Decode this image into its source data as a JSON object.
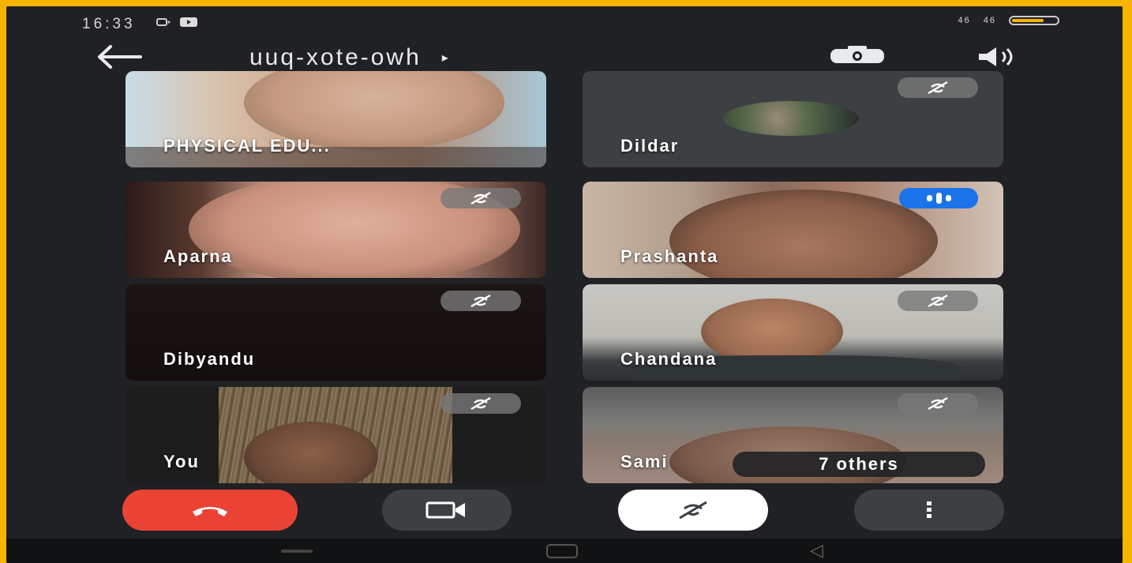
{
  "status_bar": {
    "time": "16:33",
    "network_label": "46",
    "signal_label": "46"
  },
  "header": {
    "meeting_code": "uuq-xote-owh",
    "caret": "▸",
    "back_icon": "arrow-left-icon",
    "switch_camera_icon": "switch-camera-icon",
    "audio_output_icon": "speaker-icon"
  },
  "participants": [
    {
      "name": "PHYSICAL EDU...",
      "muted": false,
      "speaking": false
    },
    {
      "name": "Dildar",
      "muted": true,
      "speaking": false
    },
    {
      "name": "Aparna",
      "muted": true,
      "speaking": false
    },
    {
      "name": "Prashanta",
      "muted": false,
      "speaking": true
    },
    {
      "name": "Dibyandu",
      "muted": true,
      "speaking": false
    },
    {
      "name": "Chandana",
      "muted": true,
      "speaking": false
    },
    {
      "name": "You",
      "muted": true,
      "speaking": false
    },
    {
      "name": "Sami",
      "muted": true,
      "speaking": false
    }
  ],
  "others_label": "7 others",
  "controls": {
    "end_call_icon": "end-call-icon",
    "camera_icon": "video-camera-icon",
    "mic_icon": "mic-off-icon",
    "more_icon": "more-vertical-icon"
  },
  "colors": {
    "frame_border": "#f5b400",
    "background": "#202124",
    "end_call": "#ea4335",
    "speaking_badge": "#1a73e8"
  }
}
